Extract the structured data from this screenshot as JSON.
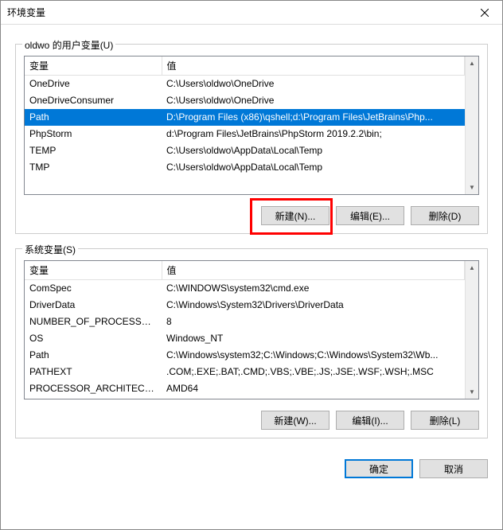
{
  "window": {
    "title": "环境变量"
  },
  "user_section": {
    "label": "oldwo 的用户变量(U)",
    "headers": {
      "name": "变量",
      "value": "值"
    },
    "rows": [
      {
        "name": "OneDrive",
        "value": "C:\\Users\\oldwo\\OneDrive",
        "selected": false
      },
      {
        "name": "OneDriveConsumer",
        "value": "C:\\Users\\oldwo\\OneDrive",
        "selected": false
      },
      {
        "name": "Path",
        "value": "D:\\Program Files (x86)\\qshell;d:\\Program Files\\JetBrains\\Php...",
        "selected": true
      },
      {
        "name": "PhpStorm",
        "value": "d:\\Program Files\\JetBrains\\PhpStorm 2019.2.2\\bin;",
        "selected": false
      },
      {
        "name": "TEMP",
        "value": "C:\\Users\\oldwo\\AppData\\Local\\Temp",
        "selected": false
      },
      {
        "name": "TMP",
        "value": "C:\\Users\\oldwo\\AppData\\Local\\Temp",
        "selected": false
      }
    ],
    "buttons": {
      "new": "新建(N)...",
      "edit": "编辑(E)...",
      "delete": "删除(D)"
    }
  },
  "sys_section": {
    "label": "系统变量(S)",
    "headers": {
      "name": "变量",
      "value": "值"
    },
    "rows": [
      {
        "name": "ComSpec",
        "value": "C:\\WINDOWS\\system32\\cmd.exe"
      },
      {
        "name": "DriverData",
        "value": "C:\\Windows\\System32\\Drivers\\DriverData"
      },
      {
        "name": "NUMBER_OF_PROCESSORS",
        "value": "8"
      },
      {
        "name": "OS",
        "value": "Windows_NT"
      },
      {
        "name": "Path",
        "value": "C:\\Windows\\system32;C:\\Windows;C:\\Windows\\System32\\Wb..."
      },
      {
        "name": "PATHEXT",
        "value": ".COM;.EXE;.BAT;.CMD;.VBS;.VBE;.JS;.JSE;.WSF;.WSH;.MSC"
      },
      {
        "name": "PROCESSOR_ARCHITECT...",
        "value": "AMD64"
      }
    ],
    "buttons": {
      "new": "新建(W)...",
      "edit": "编辑(I)...",
      "delete": "删除(L)"
    }
  },
  "dialog_buttons": {
    "ok": "确定",
    "cancel": "取消"
  }
}
